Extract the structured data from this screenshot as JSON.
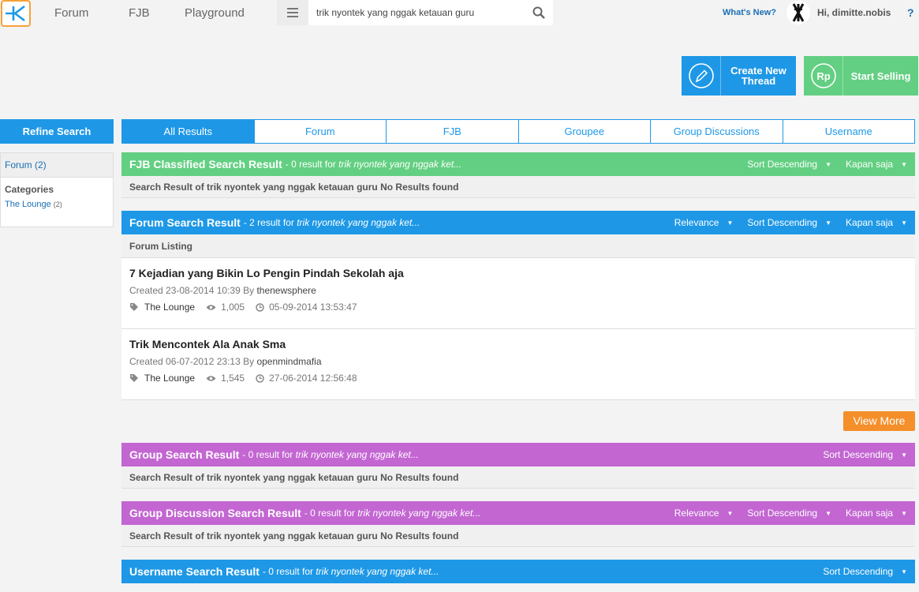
{
  "nav": {
    "links": [
      "Forum",
      "FJB",
      "Playground"
    ],
    "search_value": "trik nyontek yang nggak ketauan guru",
    "whats_new": "What's New?",
    "greeting": "Hi, dimitte.nobis",
    "help": "?"
  },
  "actions": {
    "create_thread": "Create New Thread",
    "start_selling": "Start Selling"
  },
  "sidebar": {
    "refine": "Refine Search",
    "forum_filter": "Forum (2)",
    "categories_label": "Categories",
    "category": "The Lounge",
    "category_count": "(2)"
  },
  "tabs": [
    "All Results",
    "Forum",
    "FJB",
    "Groupee",
    "Group Discussions",
    "Username"
  ],
  "sections": {
    "fjb": {
      "title": "FJB Classified Search Result",
      "meta_prefix": "- 0 result for",
      "meta_query": "trik nyontek yang nggak ket...",
      "sort": "Sort Descending",
      "time": "Kapan saja",
      "body": "Search Result of trik nyontek yang nggak ketauan guru No Results found"
    },
    "forum": {
      "title": "Forum Search Result",
      "meta_prefix": "- 2 result for",
      "meta_query": "trik nyontek yang nggak ket...",
      "relevance": "Relevance",
      "sort": "Sort Descending",
      "time": "Kapan saja",
      "listing_label": "Forum Listing",
      "posts": [
        {
          "title": "7 Kejadian yang Bikin Lo Pengin Pindah Sekolah aja",
          "created": "Created 23-08-2014 10:39 By",
          "author": "thenewsphere",
          "category": "The Lounge",
          "views": "1,005",
          "last": "05-09-2014 13:53:47"
        },
        {
          "title": "Trik Mencontek Ala Anak Sma",
          "created": "Created 06-07-2012 23:13 By",
          "author": "openmindmafia",
          "category": "The Lounge",
          "views": "1,545",
          "last": "27-06-2014 12:56:48"
        }
      ],
      "view_more": "View More"
    },
    "group": {
      "title": "Group Search Result",
      "meta_prefix": "- 0 result for",
      "meta_query": "trik nyontek yang nggak ket...",
      "sort": "Sort Descending",
      "body": "Search Result of trik nyontek yang nggak ketauan guru No Results found"
    },
    "group_discussion": {
      "title": "Group Discussion Search Result",
      "meta_prefix": "- 0 result for",
      "meta_query": "trik nyontek yang nggak ket...",
      "relevance": "Relevance",
      "sort": "Sort Descending",
      "time": "Kapan saja",
      "body": "Search Result of trik nyontek yang nggak ketauan guru No Results found"
    },
    "username": {
      "title": "Username Search Result",
      "meta_prefix": "- 0 result for",
      "meta_query": "trik nyontek yang nggak ket...",
      "sort": "Sort Descending"
    }
  },
  "colors": {
    "blue": "#1e98e6",
    "green": "#63cf82",
    "purple": "#c366d2",
    "orange": "#f48f2a",
    "logo_border": "#f7a13a"
  },
  "icons": [
    "kaskus-logo-icon",
    "hamburger-menu-icon",
    "search-icon",
    "user-avatar-icon",
    "pencil-icon",
    "rupiah-icon",
    "tag-icon",
    "eye-icon",
    "clock-icon",
    "caret-down-icon"
  ]
}
